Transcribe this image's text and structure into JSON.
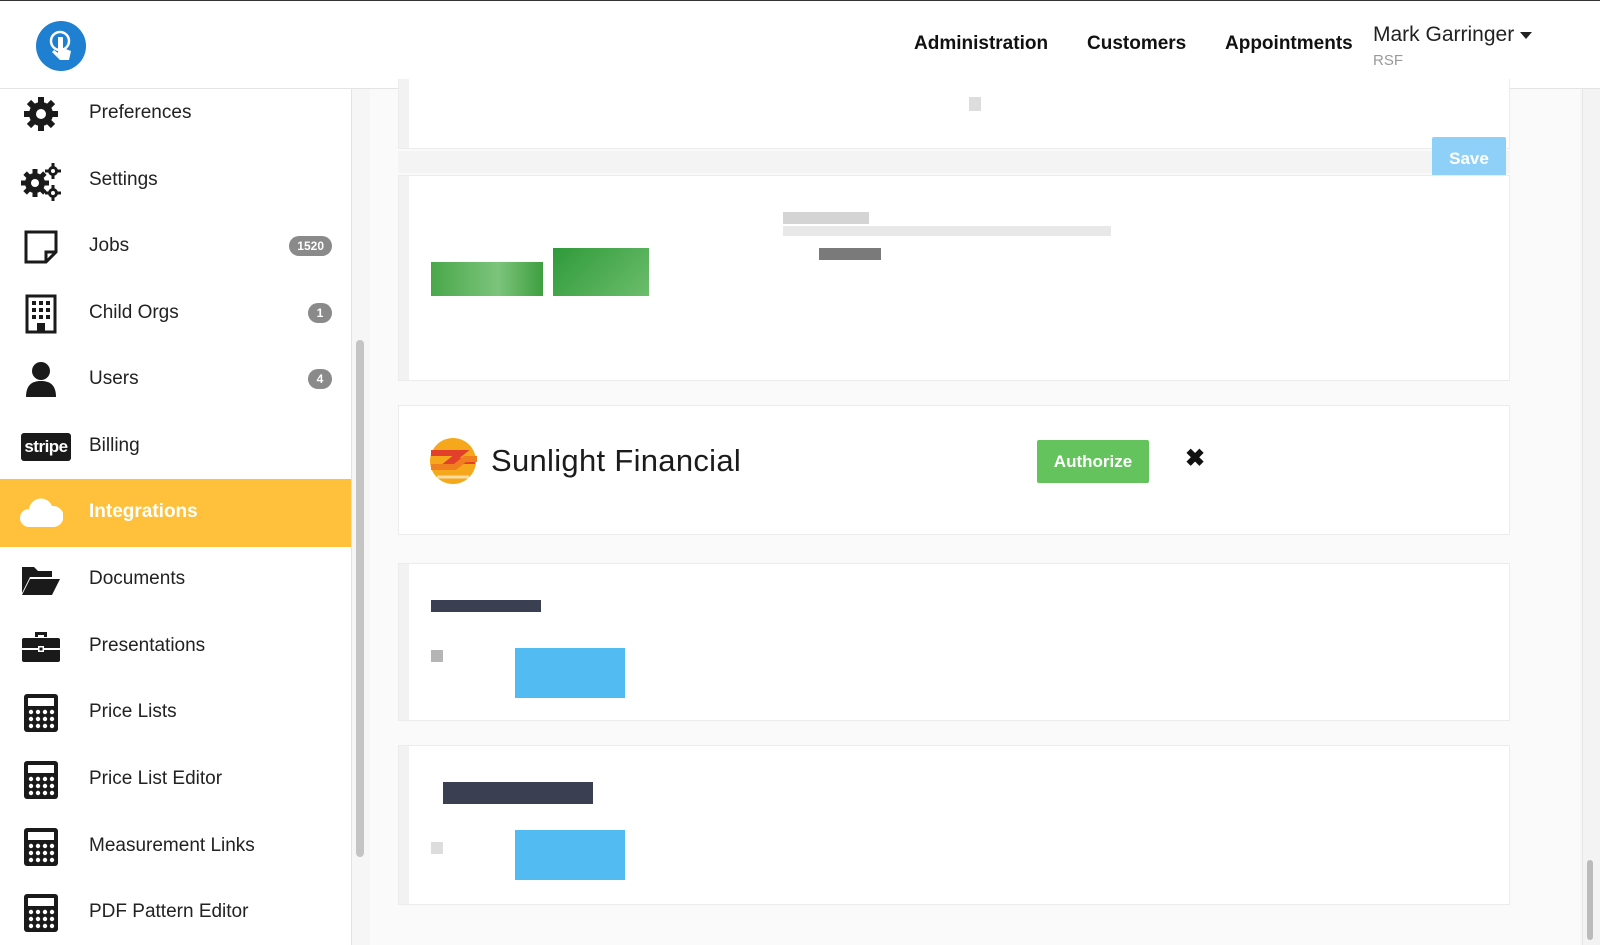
{
  "header": {
    "nav": [
      "Administration",
      "Customers",
      "Appointments"
    ],
    "user_name": "Mark Garringer",
    "user_org": "RSF"
  },
  "sidebar": {
    "items": [
      {
        "label": "Preferences",
        "icon": "gear-icon"
      },
      {
        "label": "Settings",
        "icon": "gears-icon"
      },
      {
        "label": "Jobs",
        "icon": "sticky-note-icon",
        "badge": "1520"
      },
      {
        "label": "Child Orgs",
        "icon": "building-icon",
        "badge": "1"
      },
      {
        "label": "Users",
        "icon": "user-icon",
        "badge": "4"
      },
      {
        "label": "Billing",
        "icon": "stripe-icon",
        "icon_text": "stripe"
      },
      {
        "label": "Integrations",
        "icon": "cloud-icon",
        "active": true
      },
      {
        "label": "Documents",
        "icon": "folder-open-icon"
      },
      {
        "label": "Presentations",
        "icon": "briefcase-icon"
      },
      {
        "label": "Price Lists",
        "icon": "calculator-icon"
      },
      {
        "label": "Price List Editor",
        "icon": "calculator-icon"
      },
      {
        "label": "Measurement Links",
        "icon": "calculator-icon"
      },
      {
        "label": "PDF Pattern Editor",
        "icon": "calculator-icon"
      }
    ]
  },
  "main": {
    "save_label": "Save",
    "sunlight": {
      "name": "Sunlight Financial",
      "authorize_label": "Authorize",
      "close_label": "✖"
    }
  },
  "colors": {
    "accent": "#ffc13b",
    "brand_blue": "#1f7fd0",
    "authorize_green": "#64c35c",
    "save_disabled": "#8fd0f8",
    "button_blue": "#52bbf2"
  }
}
